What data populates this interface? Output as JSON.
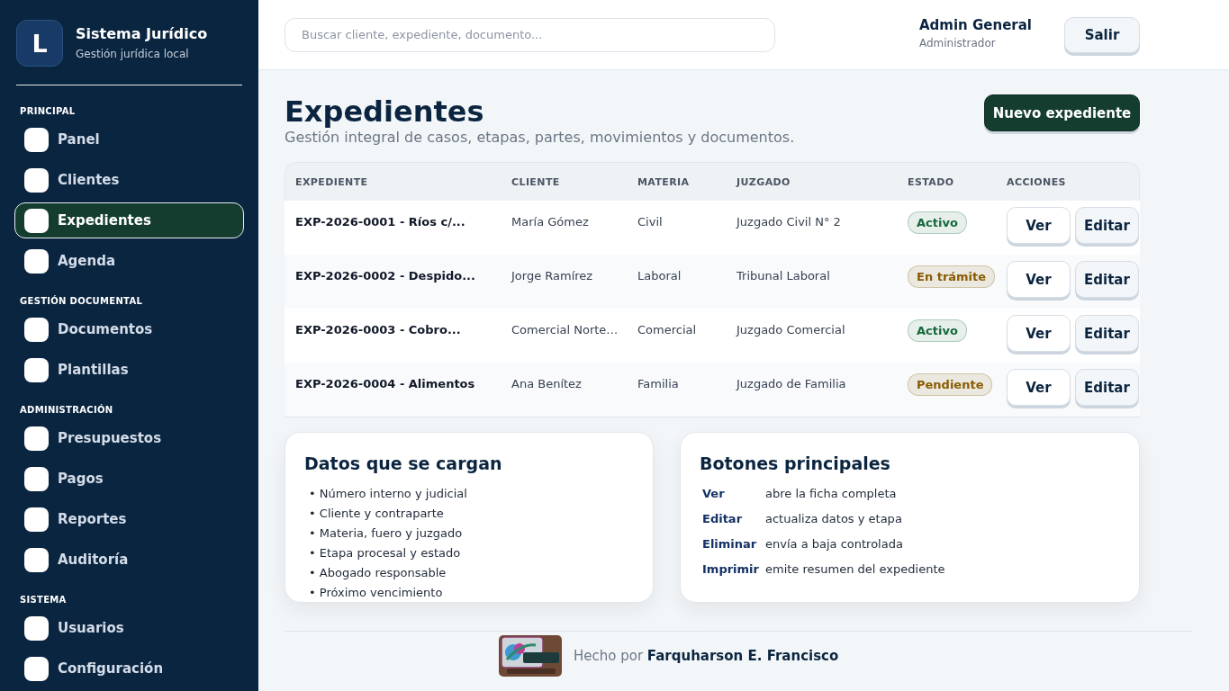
{
  "sidebar": {
    "brand": {
      "logo_letter": "L",
      "title": "Sistema Jurídico",
      "subtitle": "Gestión jurídica local"
    },
    "sections": [
      {
        "title": "PRINCIPAL",
        "items": [
          {
            "label": "Panel",
            "selected": false
          },
          {
            "label": "Clientes",
            "selected": false
          },
          {
            "label": "Expedientes",
            "selected": true
          },
          {
            "label": "Agenda",
            "selected": false
          }
        ]
      },
      {
        "title": "GESTIÓN DOCUMENTAL",
        "items": [
          {
            "label": "Documentos",
            "selected": false
          },
          {
            "label": "Plantillas",
            "selected": false
          }
        ]
      },
      {
        "title": "ADMINISTRACIÓN",
        "items": [
          {
            "label": "Presupuestos",
            "selected": false
          },
          {
            "label": "Pagos",
            "selected": false
          },
          {
            "label": "Reportes",
            "selected": false
          },
          {
            "label": "Auditoría",
            "selected": false
          }
        ]
      },
      {
        "title": "SISTEMA",
        "items": [
          {
            "label": "Usuarios",
            "selected": false
          },
          {
            "label": "Configuración",
            "selected": false
          }
        ]
      }
    ]
  },
  "topbar": {
    "search": {
      "placeholder": "Buscar cliente, expediente, documento..."
    },
    "user": {
      "name": "Admin General",
      "role": "Administrador"
    },
    "logout_button": "Salir"
  },
  "page": {
    "title": "Expedientes",
    "subtitle": "Gestión integral de casos, etapas, partes, movimientos y documentos.",
    "primary_button": "Nuevo expediente"
  },
  "table": {
    "columns": [
      "EXPEDIENTE",
      "CLIENTE",
      "MATERIA",
      "JUZGADO",
      "ESTADO",
      "ACCIONES"
    ],
    "rows": [
      {
        "expediente": "EXP-2026-0001 - Ríos c/...",
        "cliente": "María Gómez",
        "materia": "Civil",
        "juzgado": "Juzgado Civil N° 2",
        "status": {
          "label": "Activo",
          "color": "#17693d"
        },
        "actions": [
          {
            "label": "Ver",
            "kind": "view"
          },
          {
            "label": "Editar",
            "kind": "edit"
          }
        ]
      },
      {
        "expediente": "EXP-2026-0002 - Despido...",
        "cliente": "Jorge Ramírez",
        "materia": "Laboral",
        "juzgado": "Tribunal Laboral",
        "status": {
          "label": "En trámite",
          "color": "#8a5b00"
        },
        "actions": [
          {
            "label": "Ver",
            "kind": "view"
          },
          {
            "label": "Editar",
            "kind": "edit"
          }
        ]
      },
      {
        "expediente": "EXP-2026-0003 - Cobro...",
        "cliente": "Comercial Norte…",
        "materia": "Comercial",
        "juzgado": "Juzgado Comercial",
        "status": {
          "label": "Activo",
          "color": "#17693d"
        },
        "actions": [
          {
            "label": "Ver",
            "kind": "view"
          },
          {
            "label": "Editar",
            "kind": "edit"
          }
        ]
      },
      {
        "expediente": "EXP-2026-0004 - Alimentos",
        "cliente": "Ana Benítez",
        "materia": "Familia",
        "juzgado": "Juzgado de Familia",
        "status": {
          "label": "Pendiente",
          "color": "#8a5b00"
        },
        "actions": [
          {
            "label": "Ver",
            "kind": "view"
          },
          {
            "label": "Editar",
            "kind": "edit"
          }
        ]
      }
    ]
  },
  "cards": [
    {
      "kind": "bullets",
      "title": "Datos que se cargan",
      "items": [
        "• Número interno y judicial",
        "• Cliente y contraparte",
        "• Materia, fuero y juzgado",
        "• Etapa procesal y estado",
        "• Abogado responsable",
        "• Próximo vencimiento"
      ]
    },
    {
      "kind": "definitions",
      "title": "Botones principales",
      "items": [
        {
          "term": "Ver",
          "description": "abre la ficha completa"
        },
        {
          "term": "Editar",
          "description": "actualiza datos y etapa"
        },
        {
          "term": "Eliminar",
          "description": "envía a baja controlada"
        },
        {
          "term": "Imprimir",
          "description": "emite resumen del expediente"
        }
      ]
    }
  ],
  "footer": {
    "credit": "Hecho por **Farquharson E. Francisco**"
  }
}
